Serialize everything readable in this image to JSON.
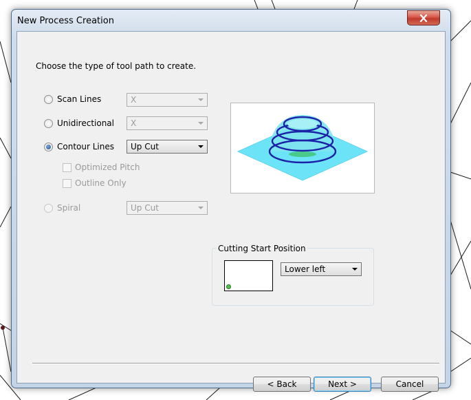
{
  "window": {
    "title": "New Process Creation"
  },
  "dialog": {
    "prompt": "Choose the type of tool path to create.",
    "options": {
      "scan_lines": {
        "label": "Scan Lines",
        "value": "X",
        "checked": false,
        "enabled": true
      },
      "unidirectional": {
        "label": "Unidirectional",
        "value": "X",
        "checked": false,
        "enabled": true
      },
      "contour_lines": {
        "label": "Contour Lines",
        "value": "Up Cut",
        "checked": true,
        "enabled": true
      },
      "spiral": {
        "label": "Spiral",
        "value": "Up Cut",
        "checked": false,
        "enabled": false
      }
    },
    "checkboxes": {
      "optimized_pitch": {
        "label": "Optimized Pitch",
        "checked": false,
        "enabled": false
      },
      "outline_only": {
        "label": "Outline Only",
        "checked": false,
        "enabled": false
      }
    },
    "cutting_start": {
      "title": "Cutting Start Position",
      "value": "Lower left"
    },
    "buttons": {
      "back": "< Back",
      "next": "Next >",
      "cancel": "Cancel"
    }
  },
  "colors": {
    "preview_plane": "#6de3f7",
    "preview_contours": "#1c22a8",
    "preview_dome": "#7fe3ee",
    "start_marker": "#4fc24a"
  },
  "icons": {
    "close": "close-x-icon"
  }
}
